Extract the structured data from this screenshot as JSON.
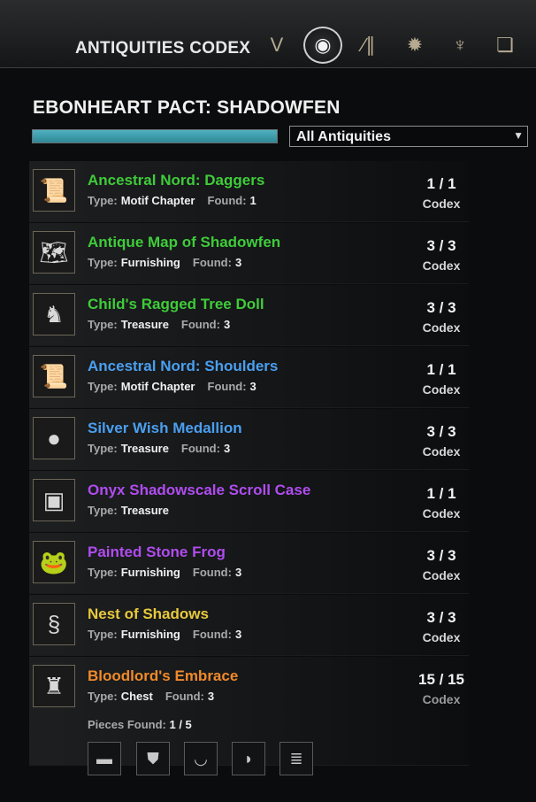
{
  "header": {
    "title": "ANTIQUITIES CODEX",
    "tabs": [
      {
        "icon": "leads-icon",
        "glyph": "V"
      },
      {
        "icon": "codex-eye-icon",
        "glyph": "◉"
      },
      {
        "icon": "library-books-icon",
        "glyph": "∕∥"
      },
      {
        "icon": "compass-star-icon",
        "glyph": "✹"
      },
      {
        "icon": "trophy-icon",
        "glyph": "♆"
      },
      {
        "icon": "open-book-icon",
        "glyph": "❏"
      }
    ]
  },
  "zone": {
    "title": "EBONHEART PACT: SHADOWFEN",
    "progress": 1.0,
    "filter": {
      "selected": "All Antiquities",
      "arrow": "▼"
    }
  },
  "items": [
    {
      "name": "Ancestral Nord: Daggers",
      "color": "#3fcc3a",
      "type_label": "Type:",
      "type": "Motif Chapter",
      "found_label": "Found:",
      "found": "1",
      "count": "1 / 1",
      "codex": "Codex",
      "icon": "scroll-icon",
      "glyph": "📜"
    },
    {
      "name": "Antique Map of Shadowfen",
      "color": "#3fcc3a",
      "type_label": "Type:",
      "type": "Furnishing",
      "found_label": "Found:",
      "found": "3",
      "count": "3 / 3",
      "codex": "Codex",
      "icon": "map-icon",
      "glyph": "🗺"
    },
    {
      "name": "Child's Ragged Tree Doll",
      "color": "#3fcc3a",
      "type_label": "Type:",
      "type": "Treasure",
      "found_label": "Found:",
      "found": "3",
      "count": "3 / 3",
      "codex": "Codex",
      "icon": "doll-icon",
      "glyph": "♞"
    },
    {
      "name": "Ancestral Nord: Shoulders",
      "color": "#4a9ff0",
      "type_label": "Type:",
      "type": "Motif Chapter",
      "found_label": "Found:",
      "found": "3",
      "count": "1 / 1",
      "codex": "Codex",
      "icon": "scroll-icon",
      "glyph": "📜"
    },
    {
      "name": "Silver Wish Medallion",
      "color": "#4a9ff0",
      "type_label": "Type:",
      "type": "Treasure",
      "found_label": "Found:",
      "found": "3",
      "count": "3 / 3",
      "codex": "Codex",
      "icon": "medallion-icon",
      "glyph": "●"
    },
    {
      "name": "Onyx Shadowscale Scroll Case",
      "color": "#b04cf0",
      "type_label": "Type:",
      "type": "Treasure",
      "found_label": "",
      "found": "",
      "count": "1 / 1",
      "codex": "Codex",
      "icon": "chest-box-icon",
      "glyph": "▣"
    },
    {
      "name": "Painted Stone Frog",
      "color": "#b04cf0",
      "type_label": "Type:",
      "type": "Furnishing",
      "found_label": "Found:",
      "found": "3",
      "count": "3 / 3",
      "codex": "Codex",
      "icon": "frog-icon",
      "glyph": "🐸"
    },
    {
      "name": "Nest of Shadows",
      "color": "#e8c93c",
      "type_label": "Type:",
      "type": "Furnishing",
      "found_label": "Found:",
      "found": "3",
      "count": "3 / 3",
      "codex": "Codex",
      "icon": "serpent-icon",
      "glyph": "§"
    },
    {
      "name": "Bloodlord's Embrace",
      "color": "#f08a2a",
      "type_label": "Type:",
      "type": "Chest",
      "found_label": "Found:",
      "found": "3",
      "count": "15 / 15",
      "codex": "Codex",
      "icon": "armor-chest-icon",
      "glyph": "♜"
    }
  ],
  "set": {
    "pieces_label": "Pieces Found:",
    "pieces_value": "1 / 5",
    "pieces": [
      {
        "icon": "belt-icon",
        "glyph": "▬"
      },
      {
        "icon": "vest-icon",
        "glyph": "⛊"
      },
      {
        "icon": "necklace-icon",
        "glyph": "◡"
      },
      {
        "icon": "pauldron-icon",
        "glyph": "◗"
      },
      {
        "icon": "armor-stack-icon",
        "glyph": "≣"
      }
    ]
  }
}
